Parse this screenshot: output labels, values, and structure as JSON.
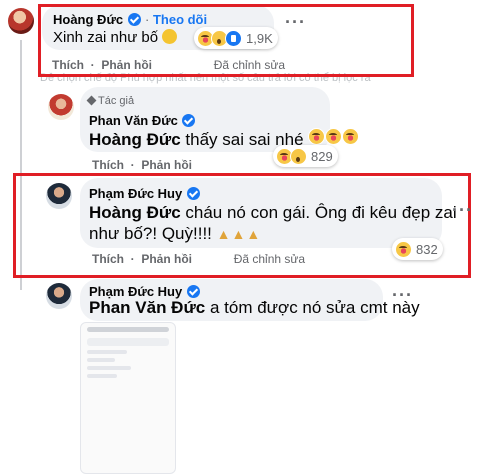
{
  "comments": [
    {
      "author": "Hoàng Đức",
      "follow_label": "Theo dõi",
      "text": "Xinh zai như bố",
      "reaction_count": "1,9K",
      "actions": {
        "like": "Thích",
        "reply": "Phản hồi",
        "edited": "Đã chỉnh sửa"
      }
    },
    {
      "author_tag": "Tác giả",
      "author": "Phan Văn Đức",
      "mention": "Hoàng Đức",
      "text": "thấy sai sai nhé",
      "reaction_count": "829",
      "actions": {
        "like": "Thích",
        "reply": "Phản hồi"
      }
    },
    {
      "author": "Phạm Đức Huy",
      "mention": "Hoàng Đức",
      "text_line1": "cháu nó con gái. Ông đi kêu đẹp zai",
      "text_line2": "như bố?! Quỳ!!!!",
      "reaction_count": "832",
      "actions": {
        "like": "Thích",
        "reply": "Phản hồi",
        "edited": "Đã chỉnh sửa"
      }
    },
    {
      "author": "Phạm Đức Huy",
      "mention": "Phan Văn Đức",
      "text": "a tóm được nó sửa cmt này"
    }
  ],
  "faded_text": "Dễ chọn chế độ Phù hợp nhất nên một số câu trả lời có thể bị lọc ra",
  "menu_dots": "···",
  "icons": [
    "verified-badge-icon",
    "haha-reaction-icon",
    "wow-reaction-icon",
    "like-reaction-icon",
    "praying-hands-emoji",
    "pen-author-icon",
    "more-options-icon"
  ],
  "colors": {
    "highlight_box": "#e01e25",
    "link_blue": "#1877f2",
    "bubble_bg": "#f0f2f5",
    "muted_text": "#65676b"
  }
}
